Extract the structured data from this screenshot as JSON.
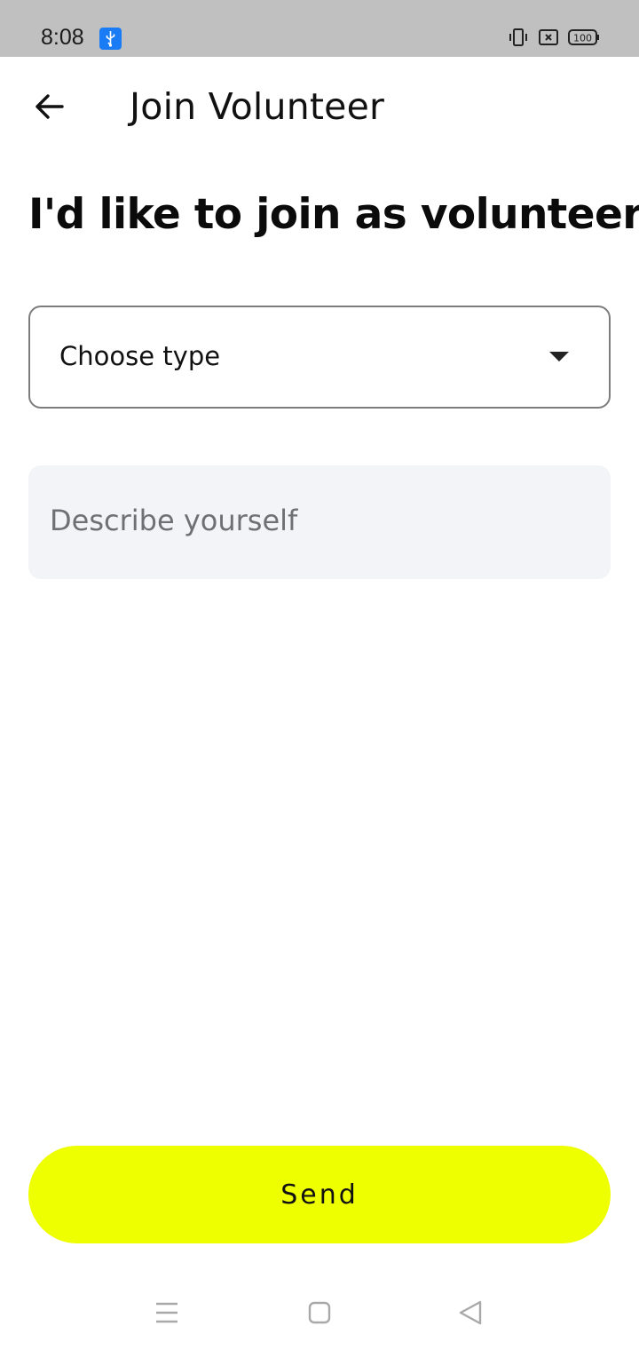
{
  "status_bar": {
    "time": "8:08",
    "battery": "100",
    "icons": [
      "usb-icon",
      "vibrate-icon",
      "sim-icon",
      "battery-icon"
    ]
  },
  "app_bar": {
    "title": "Join Volunteer",
    "back_icon": "arrow-left-icon"
  },
  "form": {
    "heading": "I'd like to join as volunteer",
    "type_select": {
      "value": "Choose type",
      "icon": "caret-down-icon"
    },
    "describe": {
      "placeholder": "Describe yourself",
      "value": ""
    },
    "send_label": "Send"
  },
  "nav_bar": {
    "icons": [
      "menu-icon",
      "home-icon",
      "back-triangle-icon"
    ]
  },
  "colors": {
    "accent": "#eeff00",
    "status_bar_bg": "#c0c0c0",
    "field_bg": "#f3f4f8",
    "usb_badge": "#1a7cf5"
  }
}
